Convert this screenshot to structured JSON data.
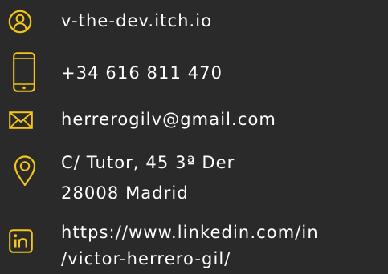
{
  "accent_color": "#f5c518",
  "background_color": "#2a2a2a",
  "contacts": [
    {
      "icon": "user-icon",
      "text": "v-the-dev.itch.io"
    },
    {
      "icon": "phone-icon",
      "text": "+34 616 811 470"
    },
    {
      "icon": "mail-icon",
      "text": "herrerogilv@gmail.com"
    },
    {
      "icon": "location-pin-icon",
      "lines": [
        "C/ Tutor, 45 3ª Der",
        "28008 Madrid"
      ]
    },
    {
      "icon": "linkedin-icon",
      "lines": [
        "https://www.linkedin.com/in",
        "/victor-herrero-gil/"
      ]
    }
  ]
}
